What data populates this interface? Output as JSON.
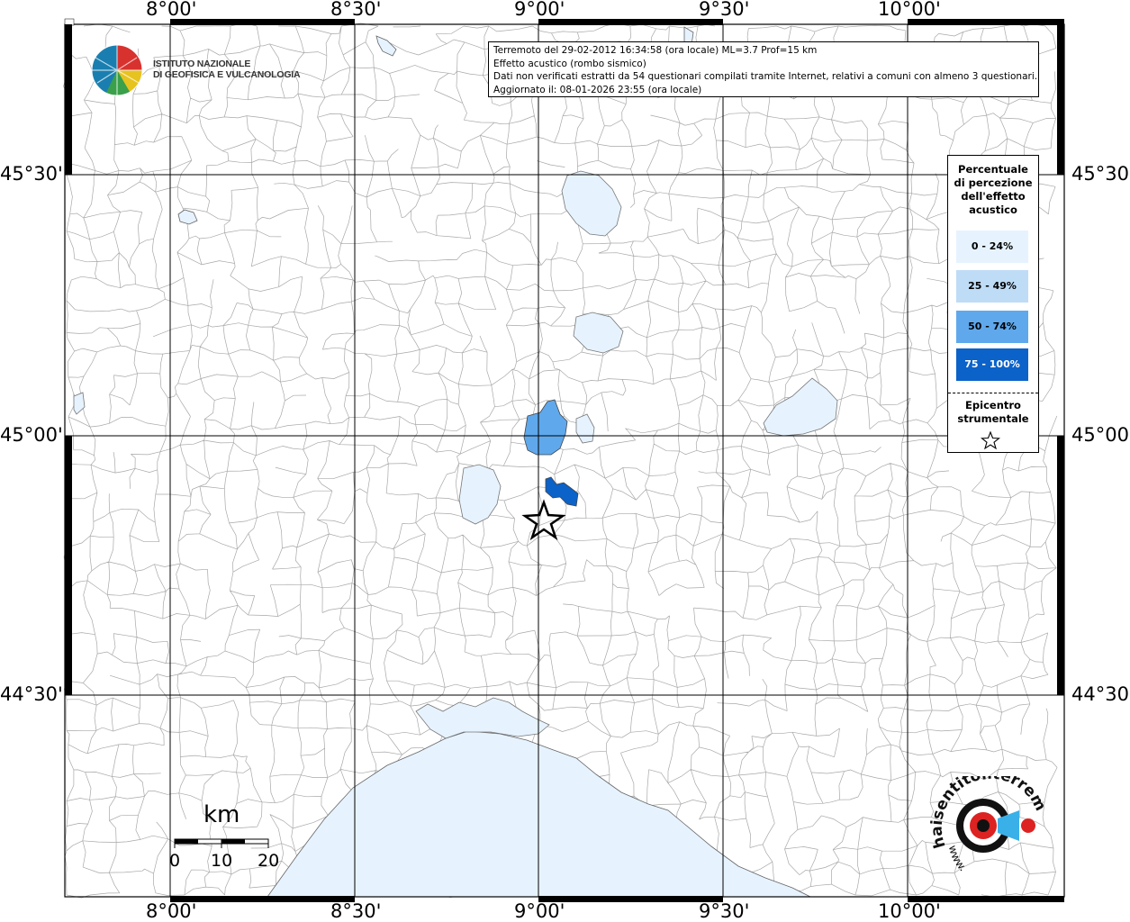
{
  "info": {
    "line1": "Terremoto del 29-02-2012 16:34:58 (ora locale) ML=3.7 Prof=15 km",
    "line2": "Effetto acustico (rombo sismico)",
    "line3": "Dati non verificati estratti da 54 questionari compilati tramite Internet, relativi a comuni con almeno 3 questionari.",
    "line4": "Aggiornato il: 08-01-2026 23:55 (ora locale)"
  },
  "institute": {
    "line1": "ISTITUTO NAZIONALE",
    "line2": "DI GEOFISICA E VULCANOLOGIA"
  },
  "axes": {
    "lon_ticks": [
      "8°00'",
      "8°30'",
      "9°00'",
      "9°30'",
      "10°00'"
    ],
    "lat_ticks": [
      "45°30'",
      "45°00'",
      "44°30'"
    ]
  },
  "legend": {
    "title": [
      "Percentuale",
      "di percezione",
      "dell'effetto",
      "acustico"
    ],
    "classes": [
      {
        "label": "0 - 24%",
        "color": "#e6f3ff",
        "text_color": "#000000"
      },
      {
        "label": "25 - 49%",
        "color": "#bedcf6",
        "text_color": "#000000"
      },
      {
        "label": "50 - 74%",
        "color": "#5fa8ec",
        "text_color": "#000000"
      },
      {
        "label": "75 - 100%",
        "color": "#0b62c9",
        "text_color": "#ffffff"
      }
    ],
    "epicenter_label": [
      "Epicentro",
      "strumentale"
    ]
  },
  "scale": {
    "unit": "km",
    "labels": [
      "0",
      "10",
      "20"
    ]
  },
  "colors": {
    "sea": "#e6f3ff",
    "lake": "#e6f3ff",
    "class_50_74": "#5fa8ec",
    "class_75_100": "#0b62c9",
    "borders": "#a8a8a8",
    "grid": "#000000"
  }
}
